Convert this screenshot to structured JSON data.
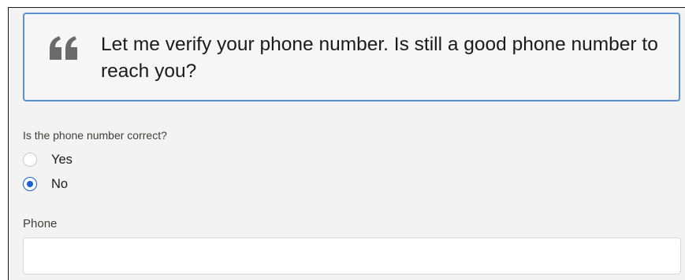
{
  "script": {
    "text": "Let me verify your phone number. Is still a good phone number to reach you?",
    "icon": "quote-icon"
  },
  "question": {
    "label": "Is the phone number correct?",
    "options": [
      {
        "label": "Yes",
        "selected": false
      },
      {
        "label": "No",
        "selected": true
      }
    ]
  },
  "phone": {
    "label": "Phone",
    "value": "",
    "placeholder": ""
  },
  "colors": {
    "script_border": "#5b8fd6",
    "radio_selected": "#1b5fd0",
    "quote_icon": "#6b6b6b"
  }
}
